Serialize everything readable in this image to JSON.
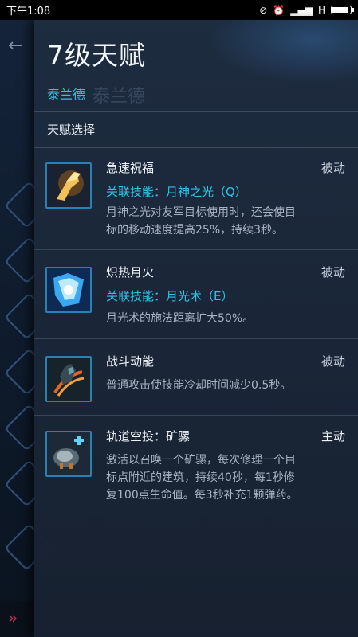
{
  "status_bar": {
    "time": "下午1:08",
    "network": "H"
  },
  "panel": {
    "title": "7级天赋",
    "hero_name": "泰兰德",
    "hero_name_ghost": "泰兰德",
    "section_label": "天赋选择"
  },
  "talents": [
    {
      "name": "急速祝福",
      "type": "被动",
      "related_skill": "关联技能：月神之光（Q）",
      "desc_line1": "月神之光对友军目标使用时，还会使目",
      "desc_line2": "标的移动速度提高25%，持续3秒。",
      "icon": "blessing-hand-icon"
    },
    {
      "name": "炽热月火",
      "type": "被动",
      "related_skill": "关联技能：月光术（E）",
      "desc_line1": "月光术的施法距离扩大50%。",
      "icon": "moonfire-icon"
    },
    {
      "name": "战斗动能",
      "type": "被动",
      "desc_line1": "普通攻击使技能冷却时间减少0.5秒。",
      "icon": "combat-momentum-icon"
    },
    {
      "name": "轨道空投：矿骡",
      "type": "主动",
      "desc_line1": "激活以召唤一个矿骡，每次修理一个目",
      "desc_line2": "标点附近的建筑，持续40秒，每1秒修",
      "desc_line3": "复100点生命值。每3秒补充1颗弹药。",
      "icon": "mule-drop-icon"
    }
  ],
  "colors": {
    "accent": "#2fc3e6",
    "panel_bg": "#1e2c40"
  }
}
